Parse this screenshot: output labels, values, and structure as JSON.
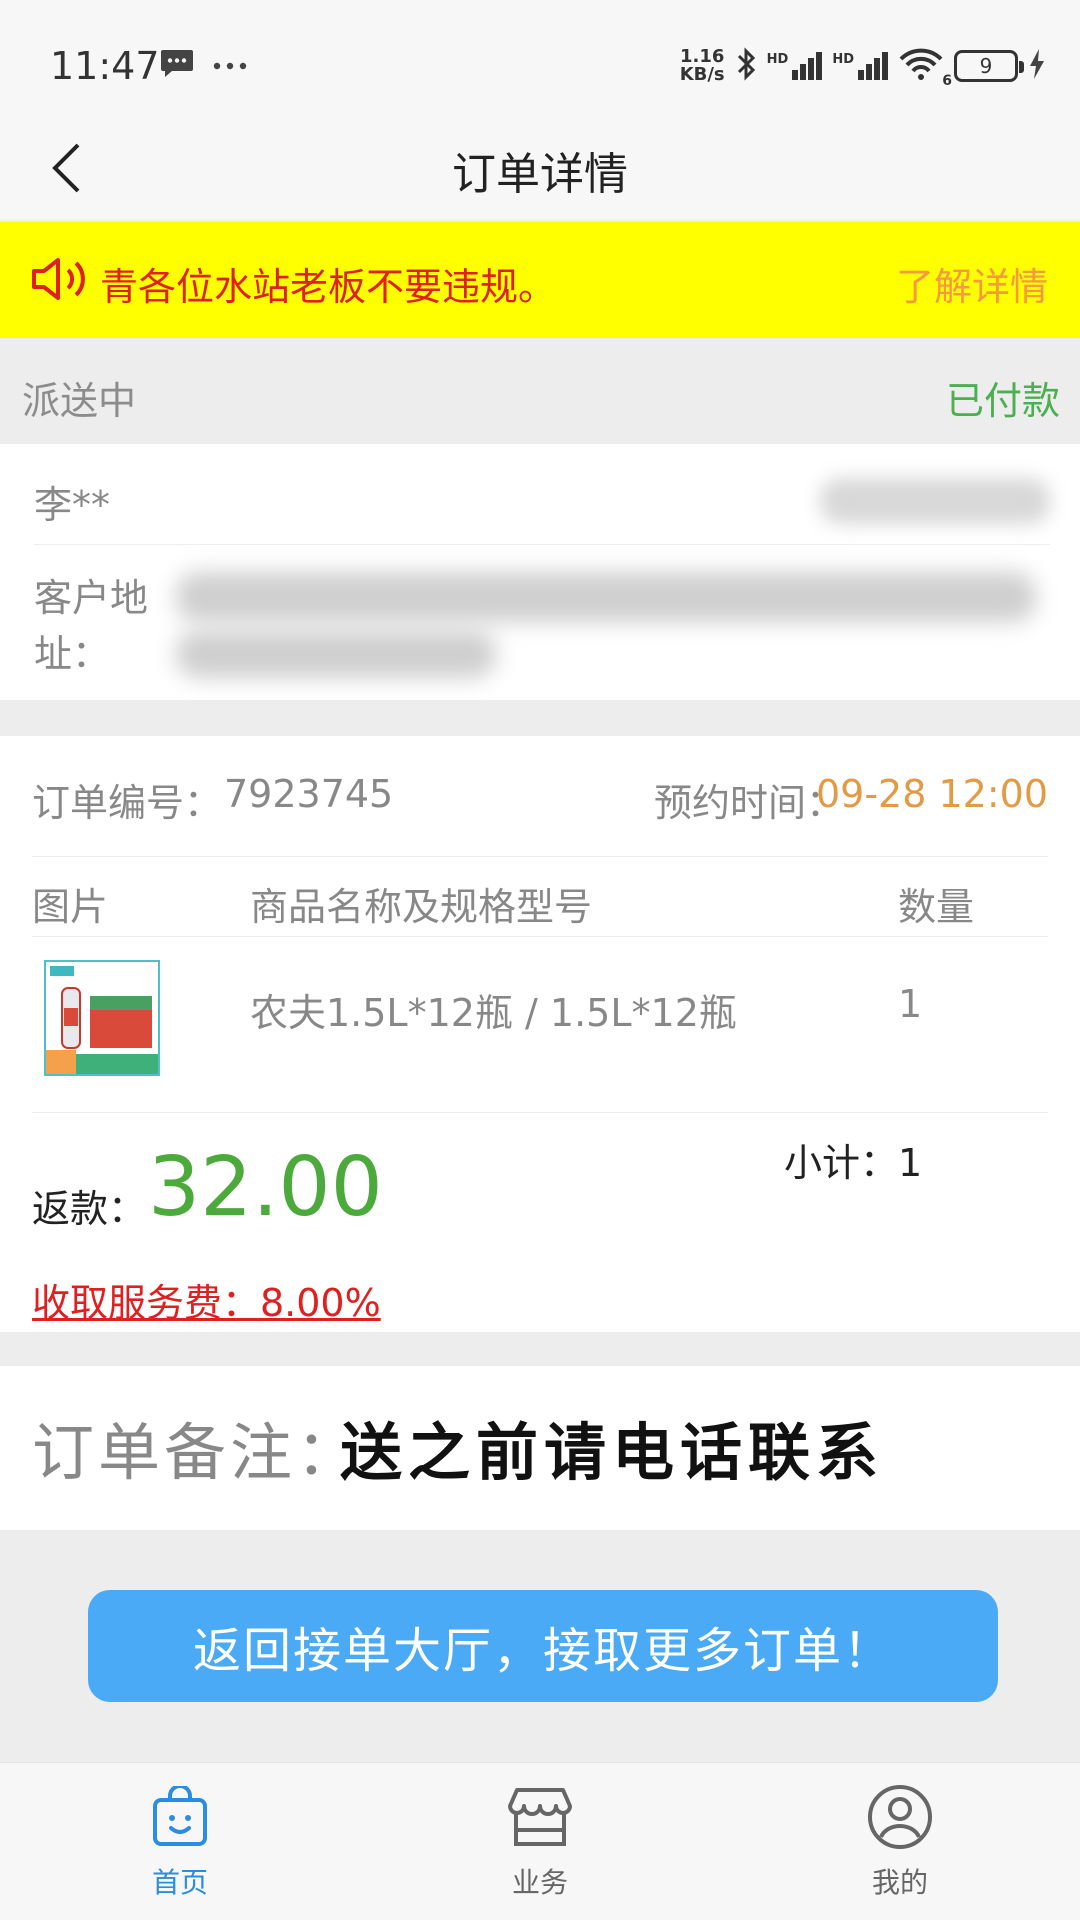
{
  "status_bar": {
    "time": "11:47",
    "net_speed_top": "1.16",
    "net_speed_bottom": "KB/s",
    "hd1": "HD",
    "hd2": "HD",
    "wifi_sub": "6",
    "battery_level": "9"
  },
  "nav": {
    "title": "订单详情"
  },
  "notice": {
    "text": "青各位水站老板不要违规。",
    "link": "了解详情"
  },
  "order_status": {
    "left": "派送中",
    "right": "已付款"
  },
  "customer": {
    "name": "李**",
    "address_label": "客户地址："
  },
  "order": {
    "number_label": "订单编号：",
    "number": "7923745",
    "appointment_label": "预约时间：",
    "appointment": "09-28 12:00",
    "columns": [
      "图片",
      "商品名称及规格型号",
      "数量"
    ],
    "items": [
      {
        "name": "农夫1.5L*12瓶 / 1.5L*12瓶",
        "qty": "1"
      }
    ],
    "subtotal": "小计：1",
    "refund_label": "返款：",
    "refund": "32.00",
    "fee": "收取服务费：8.00%"
  },
  "remark": {
    "label": "订单备注：",
    "value": "送之前请电话联系"
  },
  "return_button": "返回接单大厅，接取更多订单！",
  "tabs": [
    {
      "label": "首页",
      "icon": "home-bag-icon",
      "active": true
    },
    {
      "label": "业务",
      "icon": "store-icon",
      "active": false
    },
    {
      "label": "我的",
      "icon": "user-icon",
      "active": false
    }
  ],
  "colors": {
    "accent_blue": "#4aaaf5",
    "tab_active": "#2a8de0",
    "tab_inactive": "#666666",
    "notice_bg": "#ffff00",
    "notice_red": "#e0201f",
    "paid_green": "#4caf50",
    "refund_green": "#4caa3c",
    "appointment_orange": "#e39a45"
  }
}
